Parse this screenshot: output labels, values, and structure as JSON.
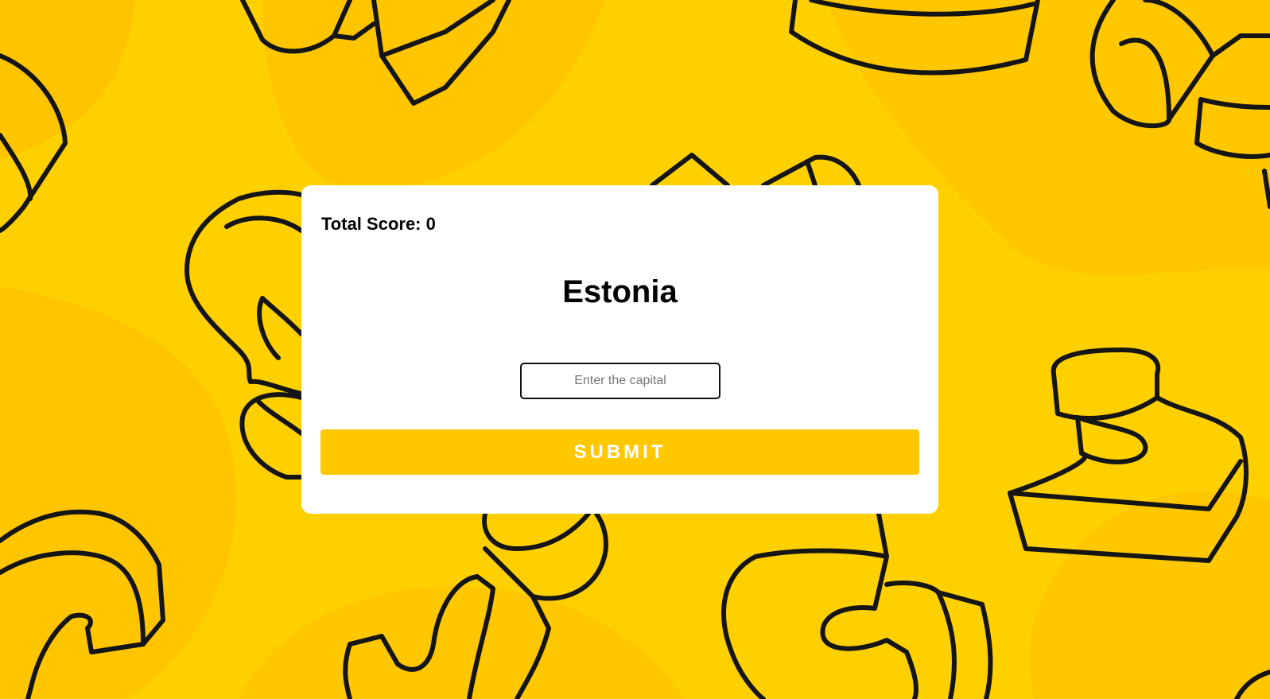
{
  "quiz": {
    "score_text": "Total Score: 0",
    "country": "Estonia",
    "input_placeholder": "Enter the capital",
    "input_value": "",
    "submit_label": "SUBMIT"
  },
  "colors": {
    "background": "#ffd000",
    "background_shade": "#ffc400",
    "card": "#ffffff",
    "accent": "#ffc800",
    "outline": "#151515"
  },
  "icons": [
    "letter-doodle-background"
  ]
}
